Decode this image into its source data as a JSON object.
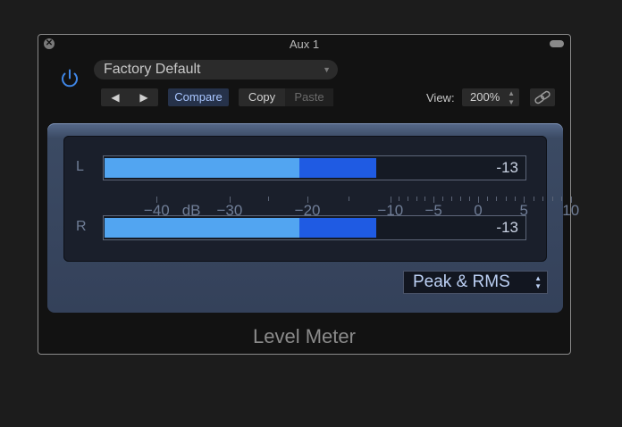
{
  "window": {
    "title": "Aux 1",
    "close_glyph": "✕"
  },
  "toolbar": {
    "preset": "Factory Default",
    "preset_arrow": "▼",
    "prev_glyph": "◀",
    "next_glyph": "▶",
    "compare_label": "Compare",
    "copy_label": "Copy",
    "paste_label": "Paste",
    "view_label": "View:",
    "zoom_value": "200%",
    "link_icon": "link-icon",
    "power_icon": "power-icon"
  },
  "meter": {
    "scale_labels": [
      "−40",
      "dB",
      "−30",
      "−20",
      "−10",
      "−5",
      "0",
      "5",
      "10"
    ],
    "channels": [
      {
        "label": "L",
        "value": "-13",
        "rms_db": -22.5,
        "peak_db": -13
      },
      {
        "label": "R",
        "value": "-13",
        "rms_db": -22.5,
        "peak_db": -13
      }
    ],
    "mode": "Peak & RMS",
    "colors": {
      "peak": "#1f5be3",
      "rms": "#52a5f1"
    }
  },
  "plugin_name": "Level Meter"
}
